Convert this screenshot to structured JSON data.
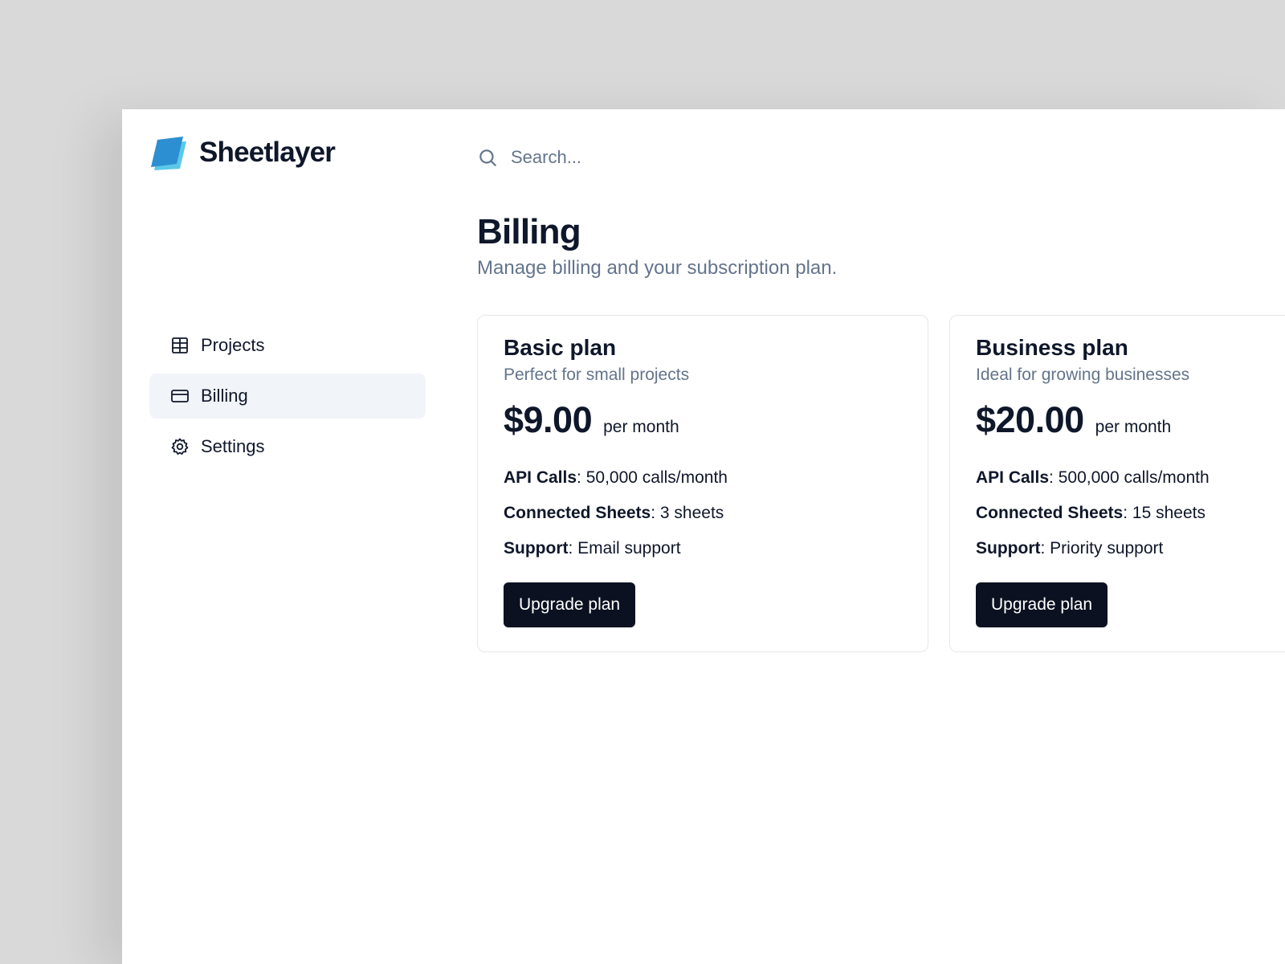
{
  "brand": {
    "name": "Sheetlayer",
    "logo_icon": "stacked-sheets-logo",
    "colors": {
      "logo_front": "#2b8fd1",
      "logo_back": "#5cc8ea"
    }
  },
  "search": {
    "placeholder": "Search...",
    "value": "",
    "icon": "search-icon"
  },
  "sidebar": {
    "items": [
      {
        "label": "Projects",
        "icon": "table-icon",
        "active": false
      },
      {
        "label": "Billing",
        "icon": "credit-card-icon",
        "active": true
      },
      {
        "label": "Settings",
        "icon": "gear-icon",
        "active": false
      }
    ]
  },
  "page": {
    "title": "Billing",
    "subtitle": "Manage billing and your subscription plan."
  },
  "plans": [
    {
      "name": "Basic plan",
      "description": "Perfect for small projects",
      "price": "$9.00",
      "period": "per month",
      "features": [
        {
          "key": "API Calls",
          "value": ": 50,000 calls/month"
        },
        {
          "key": "Connected Sheets",
          "value": ": 3 sheets"
        },
        {
          "key": "Support",
          "value": ": Email support"
        }
      ],
      "button_label": "Upgrade plan"
    },
    {
      "name": "Business plan",
      "description": "Ideal for growing businesses",
      "price": "$20.00",
      "period": "per month",
      "features": [
        {
          "key": "API Calls",
          "value": ": 500,000 calls/month"
        },
        {
          "key": "Connected Sheets",
          "value": ": 15 sheets"
        },
        {
          "key": "Support",
          "value": ": Priority support"
        }
      ],
      "button_label": "Upgrade plan"
    }
  ],
  "colors": {
    "background": "#d9d9d9",
    "surface": "#ffffff",
    "text_primary": "#0f172a",
    "text_muted": "#64748b",
    "active_nav_bg": "#f1f4f8",
    "button_bg": "#0b1120",
    "card_border": "#e5e7eb"
  }
}
